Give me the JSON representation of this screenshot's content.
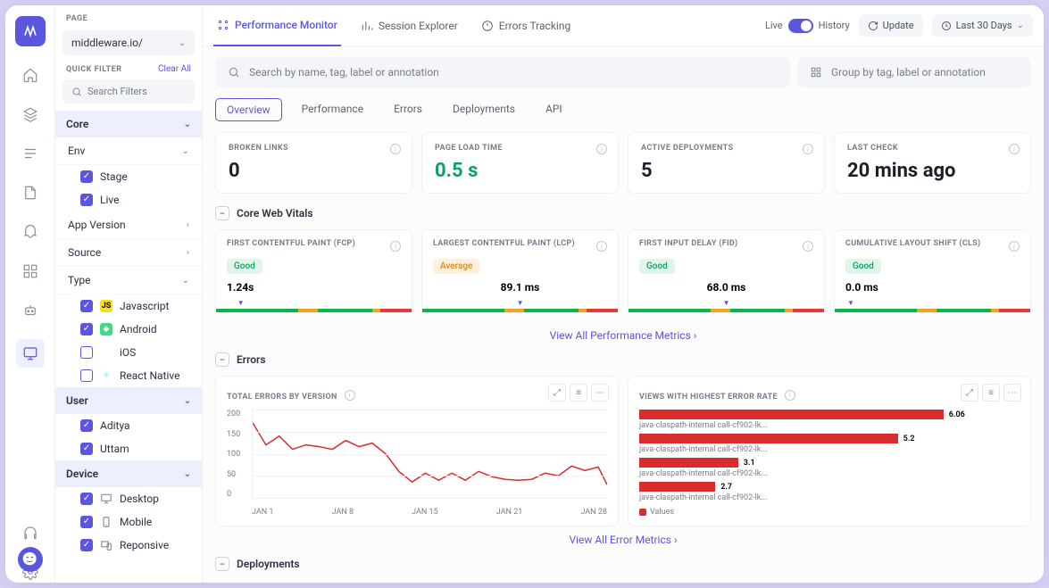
{
  "page_label": "PAGE",
  "page_selector": "middleware.io/",
  "quick_filter_label": "QUICK FILTER",
  "clear_all": "Clear All",
  "search_filters_placeholder": "Search Filters",
  "sidebar": {
    "groups": {
      "core": "Core",
      "env": "Env",
      "app_version": "App Version",
      "source": "Source",
      "type": "Type",
      "user": "User",
      "device": "Device"
    },
    "env": {
      "stage": "Stage",
      "live": "Live"
    },
    "type": {
      "js": "Javascript",
      "android": "Android",
      "ios": "iOS",
      "rn": "React Native"
    },
    "user": {
      "u1": "Aditya",
      "u2": "Uttam"
    },
    "device": {
      "desktop": "Desktop",
      "mobile": "Mobile",
      "responsive": "Reponsive"
    }
  },
  "tabs": {
    "perfmon": "Performance Monitor",
    "session": "Session Explorer",
    "errors": "Errors Tracking"
  },
  "topright": {
    "live": "Live",
    "history": "History",
    "update": "Update",
    "range": "Last 30 Days"
  },
  "search_placeholder": "Search by name, tag, label or annotation",
  "group_placeholder": "Group by tag, label or annotation",
  "subtabs": {
    "overview": "Overview",
    "performance": "Performance",
    "errors": "Errors",
    "deployments": "Deployments",
    "api": "API"
  },
  "stats": {
    "broken": {
      "label": "BROKEN LINKS",
      "val": "0"
    },
    "load": {
      "label": "PAGE LOAD TIME",
      "val": "0.5 s"
    },
    "deploy": {
      "label": "ACTIVE DEPLOYMENTS",
      "val": "5"
    },
    "last": {
      "label": "LAST CHECK",
      "val": "20 mins ago"
    }
  },
  "core_web_vitals": "Core Web Vitals",
  "vitals": {
    "fcp": {
      "label": "FIRST CONTENTFUL PAINT (FCP)",
      "badge": "Good",
      "metric": "1.24s"
    },
    "lcp": {
      "label": "LARGEST CONTENTFUL PAINT (LCP)",
      "badge": "Average",
      "metric": "89.1 ms"
    },
    "fid": {
      "label": "FIRST INPUT DELAY (FID)",
      "badge": "Good",
      "metric": "68.0 ms"
    },
    "cls": {
      "label": "CUMULATIVE LAYOUT SHIFT (CLS)",
      "badge": "Good",
      "metric": "0.0 ms"
    }
  },
  "view_all_perf": "View All Performance Metrics",
  "errors_section": "Errors",
  "err_chart": {
    "title": "TOTAL ERRORS BY VERSION",
    "y": [
      "200",
      "150",
      "100",
      "50",
      "0"
    ],
    "x": [
      "JAN 1",
      "JAN 8",
      "JAN 15",
      "JAN 21",
      "JAN 28"
    ]
  },
  "view_chart": {
    "title": "VIEWS WITH HIGHEST ERROR RATE",
    "rows": [
      {
        "val": "6.06",
        "label": "java-claspath-internal call-cf902-lk..."
      },
      {
        "val": "5.2",
        "label": "java-claspath-internal call-cf902-lk..."
      },
      {
        "val": "3.1",
        "label": "java-claspath-internal call-cf902-lk..."
      },
      {
        "val": "2.7",
        "label": "java-claspath-internal call-cf902-lk..."
      }
    ],
    "legend": "Values"
  },
  "view_all_err": "View All Error Metrics",
  "deployments_section": "Deployments",
  "chart_data": {
    "type": "line",
    "title": "TOTAL ERRORS BY VERSION",
    "xlabel": "",
    "ylabel": "",
    "ylim": [
      0,
      200
    ],
    "categories": [
      "JAN 1",
      "JAN 8",
      "JAN 15",
      "JAN 21",
      "JAN 28"
    ],
    "series": [
      {
        "name": "errors",
        "values": [
          170,
          120,
          140,
          110,
          120,
          115,
          110,
          130,
          115,
          125,
          100,
          60,
          35,
          55,
          40,
          55,
          40,
          60,
          48,
          42,
          40,
          42,
          55,
          50,
          72,
          62,
          70,
          30
        ]
      }
    ]
  }
}
